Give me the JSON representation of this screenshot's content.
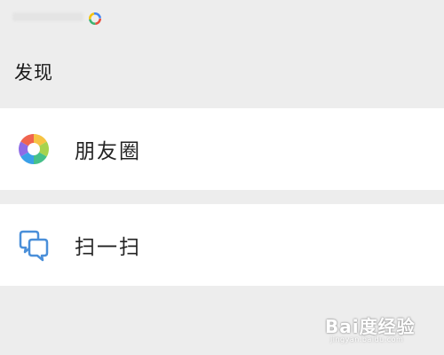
{
  "header": {
    "title": "发现"
  },
  "items": [
    {
      "label": "朋友圈",
      "icon": "moments-icon"
    },
    {
      "label": "扫一扫",
      "icon": "scan-icon"
    }
  ],
  "watermark": {
    "text": "Bai度经验",
    "subtext": "jingyan.baidu.com"
  },
  "colors": {
    "background": "#ededed",
    "item_background": "#ffffff",
    "scan_blue": "#4a8fd9"
  }
}
